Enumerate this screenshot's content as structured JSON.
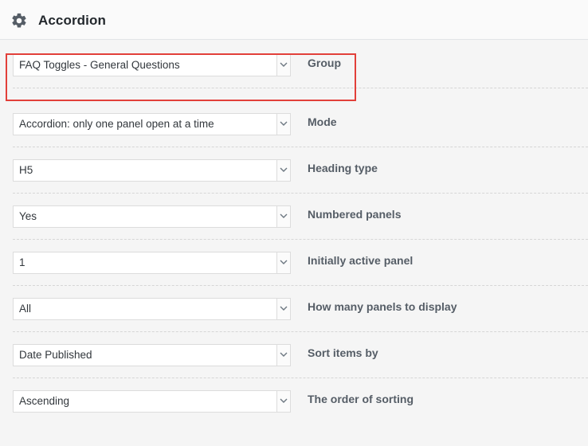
{
  "panel": {
    "title": "Accordion",
    "icon": "gear-icon"
  },
  "fields": [
    {
      "key": "group",
      "value": "FAQ Toggles - General Questions",
      "label": "Group"
    },
    {
      "key": "mode",
      "value": "Accordion: only one panel open at a time",
      "label": "Mode"
    },
    {
      "key": "heading_type",
      "value": "H5",
      "label": "Heading type"
    },
    {
      "key": "numbered_panels",
      "value": "Yes",
      "label": "Numbered panels"
    },
    {
      "key": "initially_active",
      "value": "1",
      "label": "Initially active panel"
    },
    {
      "key": "panels_to_display",
      "value": "All",
      "label": "How many panels to display"
    },
    {
      "key": "sort_items_by",
      "value": "Date Published",
      "label": "Sort items by"
    },
    {
      "key": "order_of_sorting",
      "value": "Ascending",
      "label": "The order of sorting"
    }
  ],
  "highlight_color": "#e2403a"
}
